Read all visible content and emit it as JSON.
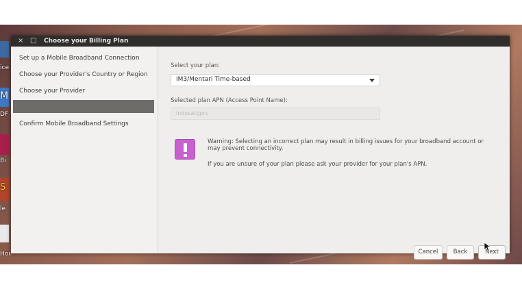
{
  "window": {
    "title": "Choose your Billing Plan",
    "close_glyph": "×",
    "maximize_glyph": "□"
  },
  "sidebar": {
    "steps": [
      {
        "label": "Set up a Mobile Broadband Connection"
      },
      {
        "label": "Choose your Provider's Country or Region"
      },
      {
        "label": "Choose your Provider"
      },
      {
        "label": ""
      },
      {
        "label": "Confirm Mobile Broadband Settings"
      }
    ]
  },
  "main": {
    "plan_label": "Select your plan:",
    "plan_value": "IM3/Mentari Time-based",
    "apn_label": "Selected plan APN (Access Point Name):",
    "apn_value": "indosatgprs",
    "warning": "Warning: Selecting an incorrect plan may result in billing issues for your broadband account or may prevent connectivity.",
    "advice": "If you are unsure of your plan please ask your provider for your plan's APN."
  },
  "buttons": {
    "cancel": "Cancel",
    "back": "Back",
    "next": "Next"
  },
  "dock": {
    "labels": [
      "ice",
      "M",
      "DF",
      "Bi",
      "S",
      "le",
      "Hom"
    ]
  },
  "colors": {
    "warning_icon": "#c860cf",
    "titlebar": "#2f2e2b",
    "selected_step": "#6e6c69"
  },
  "icons": [
    "close-icon",
    "maximize-icon",
    "warning-icon",
    "dropdown-arrow-icon",
    "mouse-cursor-icon"
  ]
}
